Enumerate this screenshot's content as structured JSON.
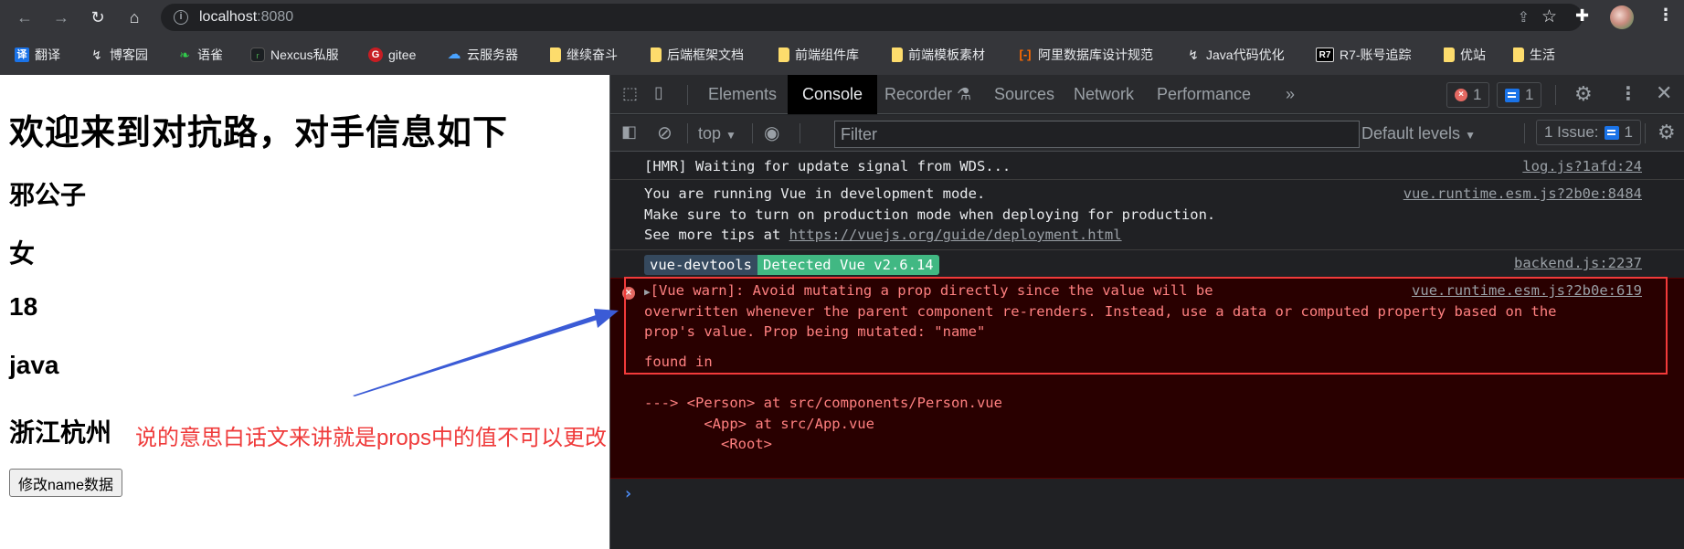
{
  "browser": {
    "url_host": "localhost",
    "url_port": ":8080",
    "nav": {
      "back": "←",
      "forward": "→",
      "reload": "↻",
      "home": "⌂"
    },
    "bookmarks": [
      {
        "label": "翻译",
        "icon": "translate-icon",
        "glyph": "译"
      },
      {
        "label": "博客园",
        "icon": "cnblogs-icon",
        "glyph": "↯"
      },
      {
        "label": "语雀",
        "icon": "yuque-icon",
        "glyph": "❧"
      },
      {
        "label": "Nexcus私服",
        "icon": "nexus-icon",
        "glyph": "r"
      },
      {
        "label": "gitee",
        "icon": "gitee-icon",
        "glyph": "G"
      },
      {
        "label": "云服务器",
        "icon": "cloud-icon",
        "glyph": "☁"
      },
      {
        "label": "继续奋斗",
        "icon": "folder-icon",
        "glyph": ""
      },
      {
        "label": "后端框架文档",
        "icon": "folder-icon",
        "glyph": ""
      },
      {
        "label": "前端组件库",
        "icon": "folder-icon",
        "glyph": ""
      },
      {
        "label": "前端模板素材",
        "icon": "folder-icon",
        "glyph": ""
      },
      {
        "label": "阿里数据库设计规范",
        "icon": "aliyun-icon",
        "glyph": "[-]"
      },
      {
        "label": "Java代码优化",
        "icon": "cnblogs-icon",
        "glyph": "↯"
      },
      {
        "label": "R7-账号追踪",
        "icon": "r7-icon",
        "glyph": "R7"
      },
      {
        "label": "优站",
        "icon": "folder-icon",
        "glyph": ""
      },
      {
        "label": "生活",
        "icon": "folder-icon",
        "glyph": ""
      }
    ]
  },
  "page": {
    "title": "欢迎来到对抗路，对手信息如下",
    "name": "邪公子",
    "sex": "女",
    "age": "18",
    "skill": "java",
    "city": "浙江杭州",
    "annotation": "说的意思白话文来讲就是props中的值不可以更改",
    "annotation_color": "#ef3b3b",
    "button_label": "修改name数据"
  },
  "devtools": {
    "tabs": [
      {
        "label": "Elements",
        "active": false
      },
      {
        "label": "Console",
        "active": true
      },
      {
        "label": "Recorder",
        "active": false
      },
      {
        "label": "Sources",
        "active": false
      },
      {
        "label": "Network",
        "active": false
      },
      {
        "label": "Performance",
        "active": false
      }
    ],
    "more_tabs": "»",
    "error_count": "1",
    "message_count": "1",
    "context": "top",
    "filter_placeholder": "Filter",
    "levels": "Default levels",
    "issues_label": "1 Issue:",
    "issues_count": "1",
    "console": {
      "hmr": {
        "text": "[HMR] Waiting for update signal from WDS...",
        "source": "log.js?1afd:24"
      },
      "vue_dev": {
        "lines": [
          "You are running Vue in development mode.",
          "Make sure to turn on production mode when deploying for production."
        ],
        "tips_prefix": "See more tips at ",
        "tips_link": "https://vuejs.org/guide/deployment.html",
        "source": "vue.runtime.esm.js?2b0e:8484"
      },
      "devtools": {
        "pill_a": "vue-devtools",
        "pill_b": "Detected Vue v2.6.14",
        "source": "backend.js:2237"
      },
      "warn": {
        "line1": "[Vue warn]: Avoid mutating a prop directly since the value will be",
        "line2": "overwritten whenever the parent component re-renders. Instead, use a data or computed property based on the",
        "line3": "prop's value. Prop being mutated: \"name\"",
        "found": "found in",
        "trace1": "---> <Person> at src/components/Person.vue",
        "trace2": "       <App> at src/App.vue",
        "trace3": "         <Root>",
        "source": "vue.runtime.esm.js?2b0e:619"
      },
      "prompt": "›"
    }
  },
  "colors": {
    "error_bg": "#290000",
    "error_text": "#ff8080",
    "highlight": "#f23a3a",
    "arrow": "#3b5bd6",
    "vue_green": "#41b883",
    "vue_navy": "#35495e"
  }
}
